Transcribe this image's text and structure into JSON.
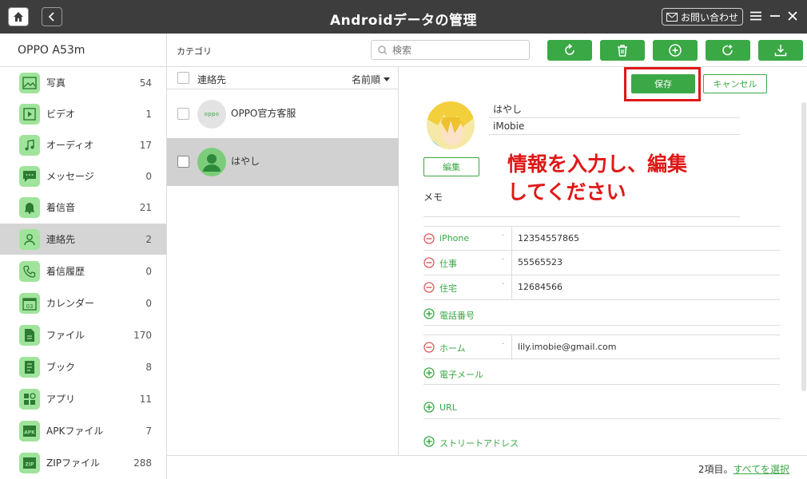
{
  "app": {
    "title": "Androidデータの管理",
    "contact_button": "お問い合わせ"
  },
  "device": {
    "name": "OPPO A53m"
  },
  "sidebar": {
    "items": [
      {
        "label": "写真",
        "count": "54"
      },
      {
        "label": "ビデオ",
        "count": "1"
      },
      {
        "label": "オーディオ",
        "count": "17"
      },
      {
        "label": "メッセージ",
        "count": "0"
      },
      {
        "label": "着信音",
        "count": "21"
      },
      {
        "label": "連絡先",
        "count": "2"
      },
      {
        "label": "着信履歴",
        "count": "0"
      },
      {
        "label": "カレンダー",
        "count": "0"
      },
      {
        "label": "ファイル",
        "count": "170"
      },
      {
        "label": "ブック",
        "count": "8"
      },
      {
        "label": "アプリ",
        "count": "11"
      },
      {
        "label": "APKファイル",
        "count": "7"
      },
      {
        "label": "ZIPファイル",
        "count": "288"
      }
    ],
    "active_index": 5,
    "icons": {
      "calendar_text": "03",
      "apk_text": "APK",
      "zip_text": "ZIP"
    }
  },
  "toolbar": {
    "category_label": "カテゴリ",
    "search_placeholder": "検索"
  },
  "list": {
    "header_title": "連絡先",
    "sort_label": "名前順",
    "rows": [
      {
        "name": "OPPO官方客服",
        "avatar_text": "oppo"
      },
      {
        "name": "はやし"
      }
    ]
  },
  "detail": {
    "save_label": "保存",
    "cancel_label": "キャンセル",
    "edit_label": "編集",
    "first_name": "はやし",
    "company": "iMobie",
    "notice_line1": "情報を入力し、編集",
    "notice_line2": "してください",
    "memo_label": "メモ",
    "phones": [
      {
        "label": "iPhone",
        "value": "12354557865"
      },
      {
        "label": "仕事",
        "value": "55565523"
      },
      {
        "label": "住宅",
        "value": "12684566"
      }
    ],
    "add_phone_label": "電話番号",
    "emails": [
      {
        "label": "ホーム",
        "value": "lily.imobie@gmail.com"
      }
    ],
    "add_email_label": "電子メール",
    "add_url_label": "URL",
    "add_address_label": "ストリートアドレス"
  },
  "status": {
    "count_text": "2項目。",
    "select_all_link": "すべてを選択"
  },
  "colors": {
    "accent_green": "#3aa845",
    "icon_green": "#9fe49a",
    "highlight_red": "#e01717",
    "titlebar": "#3d3d3d"
  }
}
